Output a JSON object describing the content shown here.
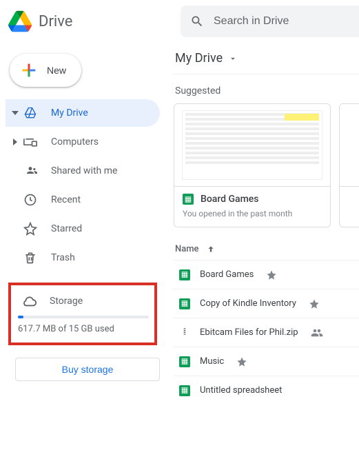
{
  "header": {
    "product": "Drive",
    "search_placeholder": "Search in Drive"
  },
  "sidebar": {
    "new_label": "New",
    "items": [
      {
        "label": "My Drive"
      },
      {
        "label": "Computers"
      },
      {
        "label": "Shared with me"
      },
      {
        "label": "Recent"
      },
      {
        "label": "Starred"
      },
      {
        "label": "Trash"
      }
    ],
    "storage": {
      "label": "Storage",
      "usage_text": "617.7 MB of 15 GB used",
      "fill_style": "width:4%"
    },
    "buy_label": "Buy storage"
  },
  "main": {
    "breadcrumb": "My Drive",
    "suggested_heading": "Suggested",
    "suggested": [
      {
        "title": "Board Games",
        "subtitle": "You opened in the past month"
      }
    ],
    "list_header": "Name",
    "files": [
      {
        "name": "Board Games",
        "type": "sheets",
        "starred": true
      },
      {
        "name": "Copy of Kindle Inventory",
        "type": "sheets",
        "starred": true
      },
      {
        "name": "Ebitcam Files for Phil.zip",
        "type": "zip",
        "shared": true
      },
      {
        "name": "Music",
        "type": "sheets",
        "starred": true
      },
      {
        "name": "Untitled spreadsheet",
        "type": "sheets"
      }
    ]
  }
}
